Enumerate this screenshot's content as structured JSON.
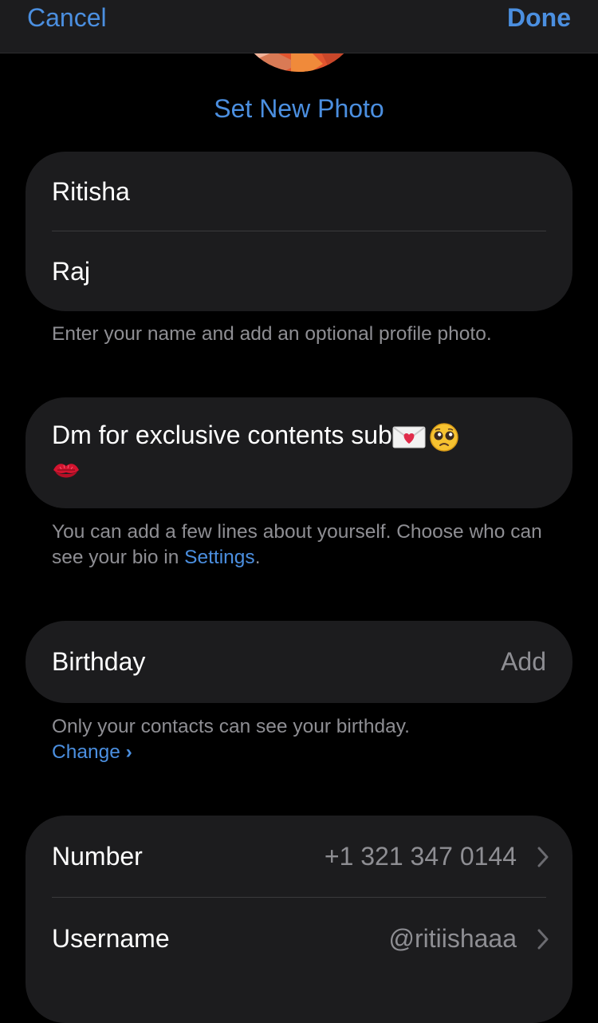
{
  "nav": {
    "cancel_label": "Cancel",
    "done_label": "Done"
  },
  "photo": {
    "set_label": "Set New Photo"
  },
  "name": {
    "first": "Ritisha",
    "last": "Raj",
    "hint": "Enter your name and add an optional profile photo."
  },
  "bio": {
    "text": "Dm for exclusive contents sub",
    "emojis": [
      "love-letter-emoji",
      "pleading-face-emoji",
      "kiss-mark-emoji"
    ],
    "hint_before": "You can add a few lines about yourself. Choose who can see your bio in ",
    "hint_link": "Settings",
    "hint_after": "."
  },
  "birthday": {
    "label": "Birthday",
    "value": "Add",
    "hint": "Only your contacts can see your birthday.",
    "change_label": "Change",
    "change_chevron": "›"
  },
  "account": {
    "number_label": "Number",
    "number_value": "+1 321 347 0144",
    "username_label": "Username",
    "username_value": "@ritiishaaa"
  },
  "colors": {
    "accent": "#4b8fe0",
    "background": "#000000",
    "card": "#1c1c1e",
    "secondary_text": "#8e8e93"
  }
}
